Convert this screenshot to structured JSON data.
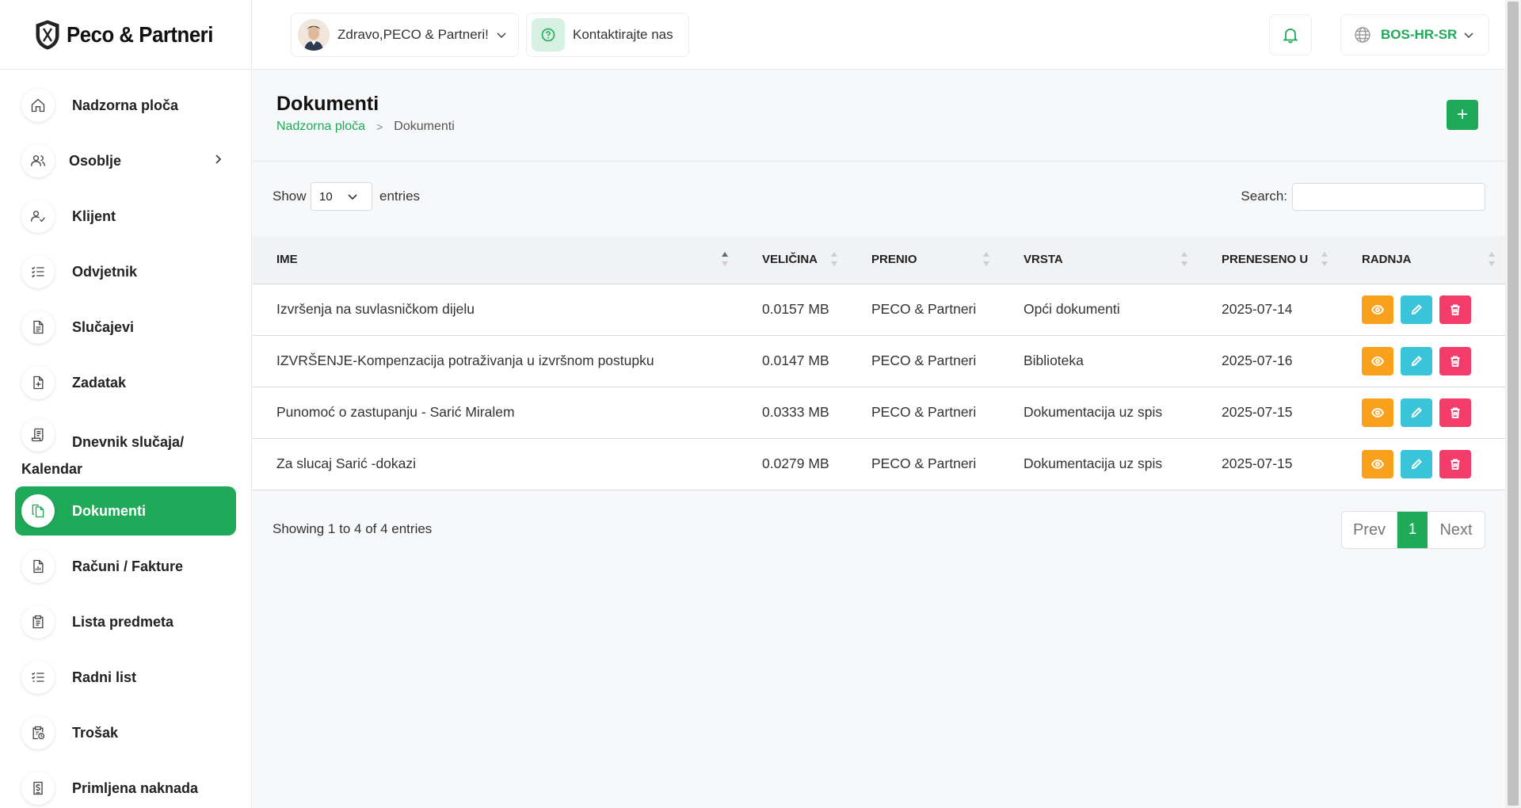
{
  "brand": {
    "name": "Peco & Partneri"
  },
  "sidebar": {
    "items": [
      {
        "label": "Nadzorna ploča",
        "icon": "home-icon"
      },
      {
        "label": "Osoblje",
        "icon": "users-icon"
      },
      {
        "label": "Klijent",
        "icon": "user-check-icon"
      },
      {
        "label": "Odvjetnik",
        "icon": "list-check-icon"
      },
      {
        "label": "Slučajevi",
        "icon": "file-icon"
      },
      {
        "label": "Zadatak",
        "icon": "file-plus-icon"
      },
      {
        "label": "Dnevnik slučaja/",
        "label2": "Kalendar",
        "icon": "journal-icon"
      },
      {
        "label": "Dokumenti",
        "icon": "documents-icon",
        "active": true
      },
      {
        "label": "Računi / Fakture",
        "icon": "invoice-icon"
      },
      {
        "label": "Lista predmeta",
        "icon": "clipboard-icon"
      },
      {
        "label": "Radni list",
        "icon": "checklist-icon"
      },
      {
        "label": "Trošak",
        "icon": "expense-icon"
      },
      {
        "label": "Primljena naknada",
        "icon": "dollar-doc-icon"
      }
    ]
  },
  "topbar": {
    "user_greeting": "Zdravo,PECO & Partneri!",
    "contact_label": "Kontaktirajte nas",
    "language": "BOS-HR-SR"
  },
  "page": {
    "title": "Dokumenti",
    "breadcrumb_home": "Nadzorna ploča",
    "breadcrumb_current": "Dokumenti",
    "add_label": "+"
  },
  "table_controls": {
    "show_label": "Show",
    "page_size": "10",
    "entries_label": "entries",
    "search_label": "Search:",
    "search_value": ""
  },
  "table": {
    "columns": [
      "IME",
      "VELIČINA",
      "PRENIO",
      "VRSTA",
      "PRENESENO U",
      "RADNJA"
    ],
    "rows": [
      {
        "name": "Izvršenja na suvlasničkom dijelu",
        "size": "0.0157 MB",
        "uploader": "PECO & Partneri",
        "type": "Opći dokumenti",
        "date": "2025-07-14"
      },
      {
        "name": "IZVRŠENJE-Kompenzacija potraživanja u izvršnom postupku",
        "size": "0.0147 MB",
        "uploader": "PECO & Partneri",
        "type": "Biblioteka",
        "date": "2025-07-16"
      },
      {
        "name": "Punomoć o zastupanju - Sarić Miralem",
        "size": "0.0333 MB",
        "uploader": "PECO & Partneri",
        "type": "Dokumentacija uz spis",
        "date": "2025-07-15"
      },
      {
        "name": "Za slucaj Sarić -dokazi",
        "size": "0.0279 MB",
        "uploader": "PECO & Partneri",
        "type": "Dokumentacija uz spis",
        "date": "2025-07-15"
      }
    ]
  },
  "footer": {
    "info": "Showing 1 to 4 of 4 entries",
    "prev": "Prev",
    "page": "1",
    "next": "Next"
  },
  "colors": {
    "accent": "#1faa59",
    "view": "#f9a11b",
    "edit": "#3ac4d9",
    "delete": "#f43c6b"
  }
}
